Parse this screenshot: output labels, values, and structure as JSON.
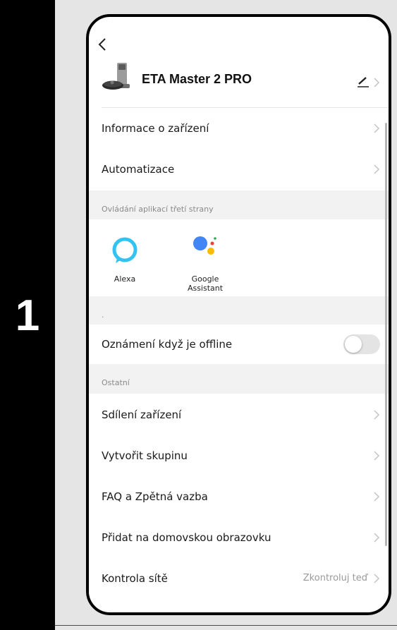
{
  "step": "1",
  "device": {
    "name": "ETA Master 2 PRO"
  },
  "rows": {
    "device_info": "Informace o zařízení",
    "automation": "Automatizace",
    "offline_notify": "Oznámení když je offline",
    "share": "Sdílení zařízení",
    "group": "Vytvořit skupinu",
    "faq": "FAQ a Zpětná vazba",
    "homescreen": "Přidat na domovskou obrazovku",
    "network": "Kontrola sítě",
    "network_value": "Zkontroluj teď"
  },
  "sections": {
    "third_party": "Ovládání aplikací třetí strany",
    "dot": ".",
    "other": "Ostatní"
  },
  "integrations": [
    {
      "label": "Alexa",
      "icon": "alexa-icon"
    },
    {
      "label": "Google Assistant",
      "icon": "google-assistant-icon"
    }
  ],
  "offline_toggle": {
    "on": false
  },
  "colors": {
    "alexa": "#31c4f3",
    "google_blue": "#4285f4",
    "google_red": "#ea4335",
    "google_yellow": "#fbbc05",
    "google_green": "#34a853"
  }
}
